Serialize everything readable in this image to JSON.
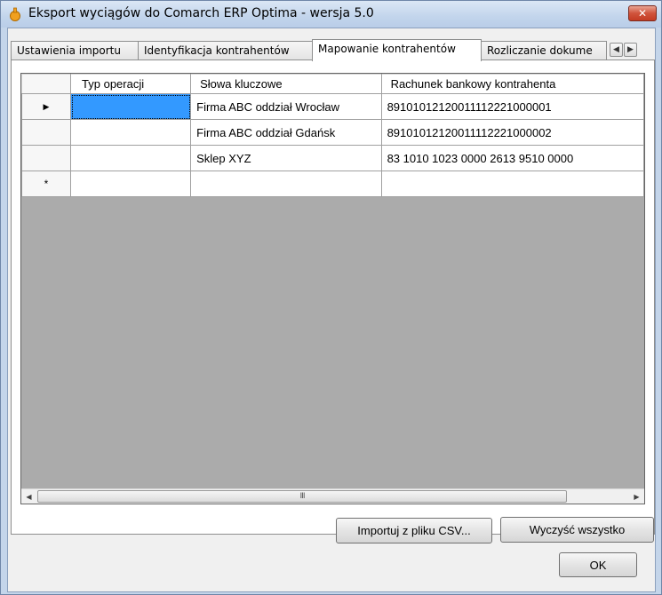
{
  "window": {
    "title": "Eksport wyciągów do Comarch ERP Optima - wersja 5.0",
    "close_glyph": "✕"
  },
  "tabs": [
    {
      "label": "Ustawienia importu"
    },
    {
      "label": "Identyfikacja kontrahentów"
    },
    {
      "label": "Mapowanie kontrahentów",
      "active": true
    },
    {
      "label": "Rozliczanie dokume"
    }
  ],
  "tab_scroll": {
    "left": "◀",
    "right": "▶"
  },
  "grid": {
    "columns": [
      "Typ operacji",
      "Słowa kluczowe",
      "Rachunek bankowy kontrahenta"
    ],
    "rows": [
      {
        "marker": "▶",
        "typ": "",
        "slowa": "Firma ABC oddział Wrocław",
        "rachunek": "89101012120011112221000001"
      },
      {
        "marker": "",
        "typ": "",
        "slowa": "Firma ABC oddział Gdańsk",
        "rachunek": "89101012120011112221000002"
      },
      {
        "marker": "",
        "typ": "",
        "slowa": "Sklep XYZ",
        "rachunek": "83 1010 1023 0000 2613 9510 0000"
      },
      {
        "marker": "*",
        "typ": "",
        "slowa": "",
        "rachunek": ""
      }
    ],
    "scroll_thumb": "III",
    "scroll_left": "◀",
    "scroll_right": "▶"
  },
  "buttons": {
    "import_csv": "Importuj z pliku CSV...",
    "clear_all": "Wyczyść wszystko",
    "ok": "OK"
  },
  "colors": {
    "selection": "#3399ff",
    "grid_background": "#ababab"
  }
}
